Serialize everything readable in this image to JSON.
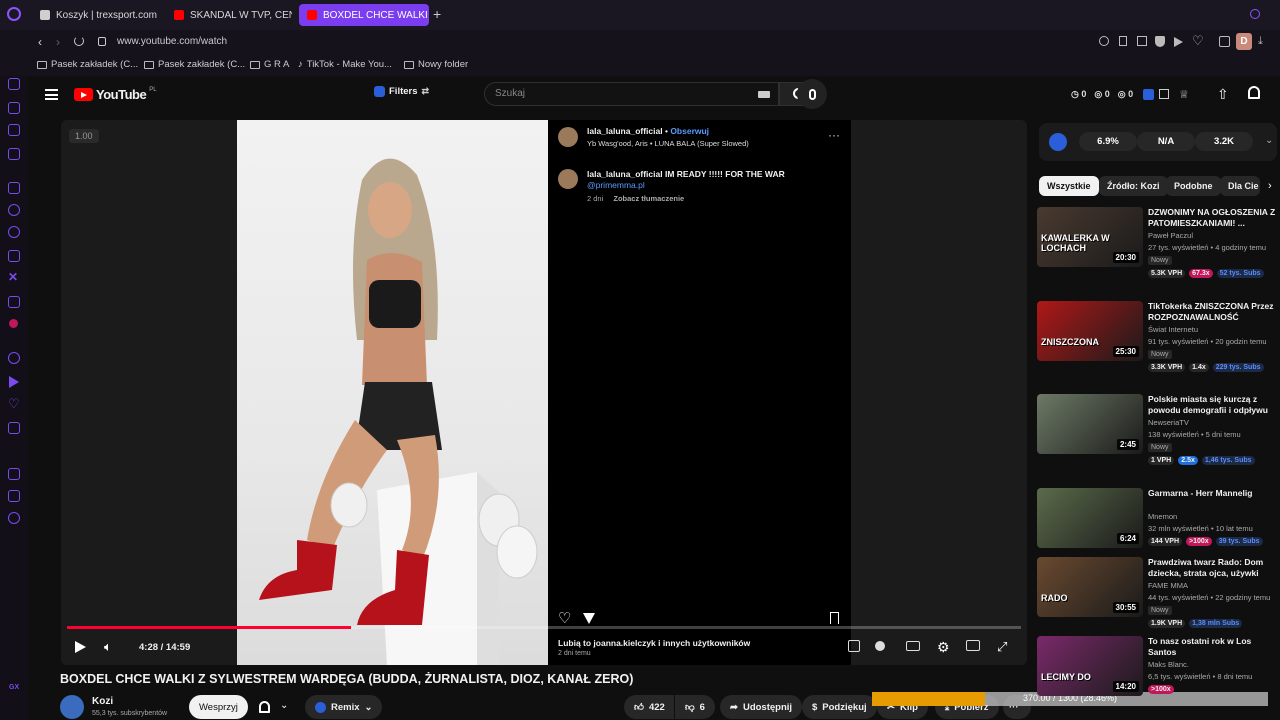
{
  "browser": {
    "tabs": [
      {
        "label": "Koszyk | trexsport.com",
        "fav_color": "#cfcfcf"
      },
      {
        "label": "SKANDAL W TVP, CENZU",
        "fav_color": "#ff0000"
      },
      {
        "label": "BOXDEL CHCE WALKI Z S",
        "fav_color": "#ff0000"
      }
    ],
    "url": "www.youtube.com/watch",
    "bookmarks": [
      "Pasek zakładek (C...",
      "Pasek zakładek (C...",
      "G R A",
      "TikTok - Make You...",
      "Nowy folder"
    ],
    "profile_letter": "D"
  },
  "yt_header": {
    "logo_text": "YouTube",
    "region": "PL",
    "filters_label": "Filters",
    "search_placeholder": "Szukaj",
    "counters": [
      "0",
      "0",
      "0"
    ]
  },
  "player": {
    "speed_overlay": "1.00",
    "time": "4:28 / 14:59",
    "progress_fraction": 0.298,
    "ig": {
      "username": "lala_laluna_official",
      "follow": "Obserwuj",
      "audio": "Yb Wasg'ood, Aris • LUNA BALA (Super Slowed)",
      "comment_user": "lala_laluna_official",
      "comment_text": "IM READY !!!!! FOR THE WAR",
      "comment_mention": "@primemma.pl",
      "comment_age": "2 dni",
      "translate": "Zobacz tłumaczenie",
      "likes": "Lubią to joanna.kielczyk i innych użytkowników",
      "post_age": "2 dni temu"
    }
  },
  "video": {
    "title": "BOXDEL CHCE WALKI Z SYLWESTREM WARDĘGA (BUDDA, ŻURNALISTA, DIOZ, KANAŁ ZERO)",
    "channel": "Kozi",
    "subscribers": "55,3 tys. subskrybentów",
    "support_label": "Wesprzyj",
    "remix_label": "Remix",
    "likes": "422",
    "dislikes": "6",
    "share_label": "Udostępnij",
    "thanks_label": "Podziękuj",
    "clip_label": "Klip",
    "download_label": "Pobierz",
    "download_progress_text": "370.00 / 1300 (28.46%)",
    "download_progress_fraction": 0.2846
  },
  "sidebar": {
    "stats": [
      "6.9%",
      "N/A",
      "3.2K"
    ],
    "chips": [
      "Wszystkie",
      "Źródło: Kozi",
      "Podobne",
      "Dla Cie"
    ],
    "recs": [
      {
        "title": "DZWONIMY NA OGŁOSZENIA Z PATOMIESZKANIAMI! ...",
        "channel": "Paweł Paczul",
        "meta": "27 tys. wyświetleń • 4 godziny temu",
        "badge": "Nowy",
        "vph": "5.3K VPH",
        "mult": "67.3x",
        "mult_color": "#c2185b",
        "subs": "52 tys. Subs",
        "duration": "20:30",
        "thumb_text": "KAWALERKA W LOCHACH",
        "thumb_bg": "#4a3a30"
      },
      {
        "title": "TikTokerka ZNISZCZONA Przez ROZPOZNAWALNOŚĆ",
        "channel": "Świat Internetu",
        "meta": "91 tys. wyświetleń • 20 godzin temu",
        "badge": "Nowy",
        "vph": "3.3K VPH",
        "mult": "1.4x",
        "mult_color": "#272727",
        "subs": "229 tys. Subs",
        "duration": "25:30",
        "thumb_text": "ZNISZCZONA",
        "thumb_bg": "#b01818"
      },
      {
        "title": "Polskie miasta się kurczą z powodu demografii i odpływu ...",
        "channel": "NewseriaTV",
        "meta": "138 wyświetleń • 5 dni temu",
        "badge": "Nowy",
        "vph": "1 VPH",
        "mult": "2.5x",
        "mult_color": "#1e6fd9",
        "subs": "1,46 tys. Subs",
        "duration": "2:45",
        "thumb_text": "",
        "thumb_bg": "#6d7a66"
      },
      {
        "title": "Garmarna - Herr Mannelig",
        "channel": "Mnemon",
        "meta": "32 mln wyświetleń • 10 lat temu",
        "badge": "",
        "vph": "144 VPH",
        "mult": ">100x",
        "mult_color": "#c2185b",
        "subs": "39 tys. Subs",
        "duration": "6:24",
        "thumb_text": "",
        "thumb_bg": "#5b6b4a"
      },
      {
        "title": "Prawdziwa twarz Rado: Dom dziecka, strata ojca, używki",
        "channel": "FAME MMA",
        "meta": "44 tys. wyświetleń • 22 godziny temu",
        "badge": "Nowy",
        "vph": "1.9K VPH",
        "mult": "",
        "mult_color": "#272727",
        "subs": "1,38 mln Subs",
        "duration": "30:55",
        "thumb_text": "RADO",
        "thumb_bg": "#6a4a30"
      },
      {
        "title": "To nasz ostatni rok w Los Santos",
        "channel": "Maks Blanc.",
        "meta": "6,5 tys. wyświetleń • 8 dni temu",
        "badge": "",
        "vph": "",
        "mult": ">100x",
        "mult_color": "#c2185b",
        "subs": "",
        "duration": "14:20",
        "thumb_text": "LECIMY DO",
        "thumb_bg": "#7a2a6a"
      }
    ]
  }
}
